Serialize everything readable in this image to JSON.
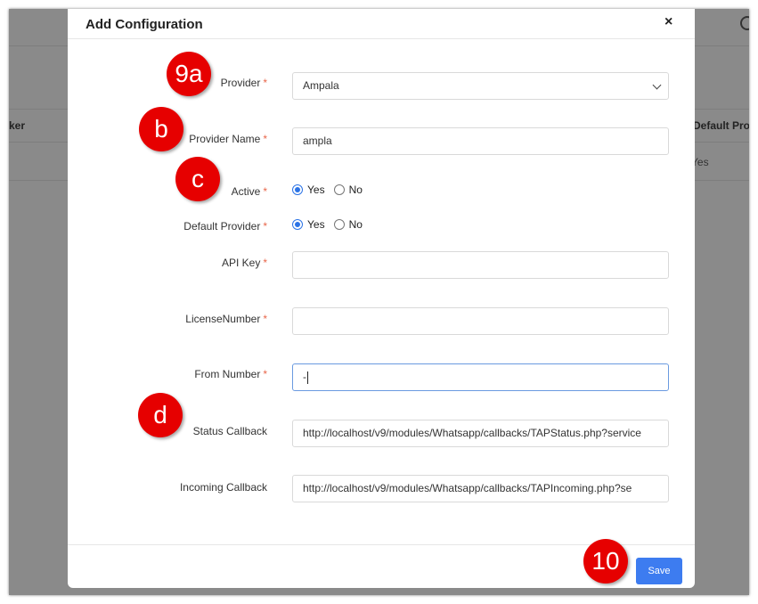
{
  "background": {
    "table_header_left": "ker",
    "table_header_right": "Default Provi",
    "table_cell_right": "Yes"
  },
  "modal": {
    "title": "Add Configuration",
    "close_glyph": "×",
    "fields": {
      "provider": {
        "label": "Provider",
        "value": "Ampala"
      },
      "provider_name": {
        "label": "Provider Name",
        "value": "ampla"
      },
      "active": {
        "label": "Active",
        "options": [
          "Yes",
          "No"
        ],
        "selected": "Yes"
      },
      "default_provider": {
        "label": "Default Provider",
        "options": [
          "Yes",
          "No"
        ],
        "selected": "Yes"
      },
      "api_key": {
        "label": "API Key",
        "value": ""
      },
      "license_number": {
        "label": "LicenseNumber",
        "value": ""
      },
      "from_number": {
        "label": "From Number",
        "value": "-"
      },
      "status_callback": {
        "label": "Status Callback",
        "value": "http://localhost/v9/modules/Whatsapp/callbacks/TAPStatus.php?service"
      },
      "incoming_callback": {
        "label": "Incoming Callback",
        "value": "http://localhost/v9/modules/Whatsapp/callbacks/TAPIncoming.php?se"
      }
    },
    "required_marker": "*",
    "save_label": "Save"
  },
  "annotations": {
    "badge_9a": "9a",
    "badge_b": "b",
    "badge_c": "c",
    "badge_d": "d",
    "badge_10": "10"
  },
  "colors": {
    "primary": "#3d7cf0",
    "required": "#e8664a",
    "badge": "#e60000"
  }
}
